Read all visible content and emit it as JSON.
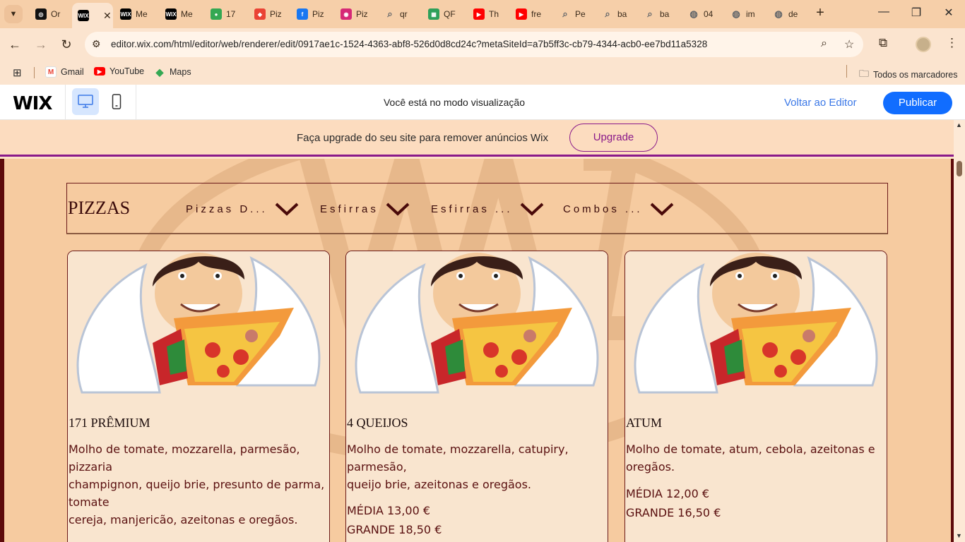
{
  "browser": {
    "tabs": [
      {
        "icon": "openai-icon",
        "title": "Or",
        "color": "#111111",
        "glyph": "◎"
      },
      {
        "icon": "wix-icon",
        "title": "",
        "color": "#000000",
        "glyph": "WIX",
        "active": true
      },
      {
        "icon": "wix-icon",
        "title": "Me",
        "color": "#000000",
        "glyph": "WIX"
      },
      {
        "icon": "wix-icon",
        "title": "Me",
        "color": "#000000",
        "glyph": "WIX"
      },
      {
        "icon": "maps-pin-icon",
        "title": "17",
        "color": "#34a853",
        "glyph": "●"
      },
      {
        "icon": "google-maps-icon",
        "title": "Piz",
        "color": "#ea4335",
        "glyph": "◆"
      },
      {
        "icon": "facebook-icon",
        "title": "Piz",
        "color": "#1877f2",
        "glyph": "f"
      },
      {
        "icon": "instagram-icon",
        "title": "Piz",
        "color": "#d62976",
        "glyph": "◉"
      },
      {
        "icon": "search-icon",
        "title": "qr",
        "color": "#5f6368",
        "glyph": "⌕"
      },
      {
        "icon": "qr-icon",
        "title": "QF",
        "color": "#2ea05a",
        "glyph": "▦"
      },
      {
        "icon": "youtube-icon",
        "title": "Th",
        "color": "#ff0000",
        "glyph": "▶"
      },
      {
        "icon": "youtube-icon",
        "title": "fre",
        "color": "#ff0000",
        "glyph": "▶"
      },
      {
        "icon": "search-icon",
        "title": "Pe",
        "color": "#5f6368",
        "glyph": "⌕"
      },
      {
        "icon": "search-icon",
        "title": "ba",
        "color": "#5f6368",
        "glyph": "⌕"
      },
      {
        "icon": "search-icon",
        "title": "ba",
        "color": "#5f6368",
        "glyph": "⌕"
      },
      {
        "icon": "globe-icon",
        "title": "04",
        "color": "#5f6368",
        "glyph": "◍"
      },
      {
        "icon": "globe-icon",
        "title": "im",
        "color": "#5f6368",
        "glyph": "◍"
      },
      {
        "icon": "globe-icon",
        "title": "de",
        "color": "#5f6368",
        "glyph": "◍"
      }
    ],
    "new_tab": "+",
    "url": "editor.wix.com/html/editor/web/renderer/edit/0917ae1c-1524-4363-abf8-526d0d8cd24c?metaSiteId=a7b5ff3c-cb79-4344-acb0-ee7bd11a5328",
    "bookmarks": [
      {
        "label": "Gmail",
        "icon": "gmail-icon"
      },
      {
        "label": "YouTube",
        "icon": "youtube-icon"
      },
      {
        "label": "Maps",
        "icon": "google-maps-icon"
      }
    ],
    "all_bookmarks": "Todos os marcadores"
  },
  "wix": {
    "logo": "WIX",
    "preview_message": "Você está no modo visualização",
    "back_to_editor": "Voltar ao Editor",
    "publish": "Publicar",
    "upgrade_message": "Faça upgrade do seu site para remover anúncios Wix",
    "upgrade_button": "Upgrade"
  },
  "site": {
    "nav_title": "PIZZAS",
    "nav_items": [
      "Pizzas D...",
      "Esfirras",
      "Esfirras ...",
      "Combos ..."
    ],
    "cards": [
      {
        "title": "171 PRÊMIUM",
        "description": "Molho de tomate, mozzarella, parmesão, pizzaria\nchampignon, queijo brie, presunto de parma, tomate\ncereja, manjericão, azeitonas e oregãos.",
        "price_medium": "",
        "price_large": ""
      },
      {
        "title": "4 QUEIJOS",
        "description": "Molho de tomate, mozzarella, catupiry, parmesão,\nqueijo brie, azeitonas e oregãos.",
        "price_medium": "MÉDIA  13,00 €",
        "price_large": "GRANDE  18,50 €"
      },
      {
        "title": "ATUM",
        "description": "Molho de tomate, atum, cebola, azeitonas e oregãos.",
        "price_medium": "MÉDIA  12,00 €",
        "price_large": "GRANDE  16,50 €"
      }
    ]
  },
  "colors": {
    "browser_frame": "#f6cfa9",
    "wix_blue": "#116dff",
    "upgrade_purple": "#8a1a8a",
    "site_background": "#f6cba0",
    "site_border": "#5e0a0a",
    "card_background": "#f9e5cf",
    "text_brown": "#5a1010"
  }
}
